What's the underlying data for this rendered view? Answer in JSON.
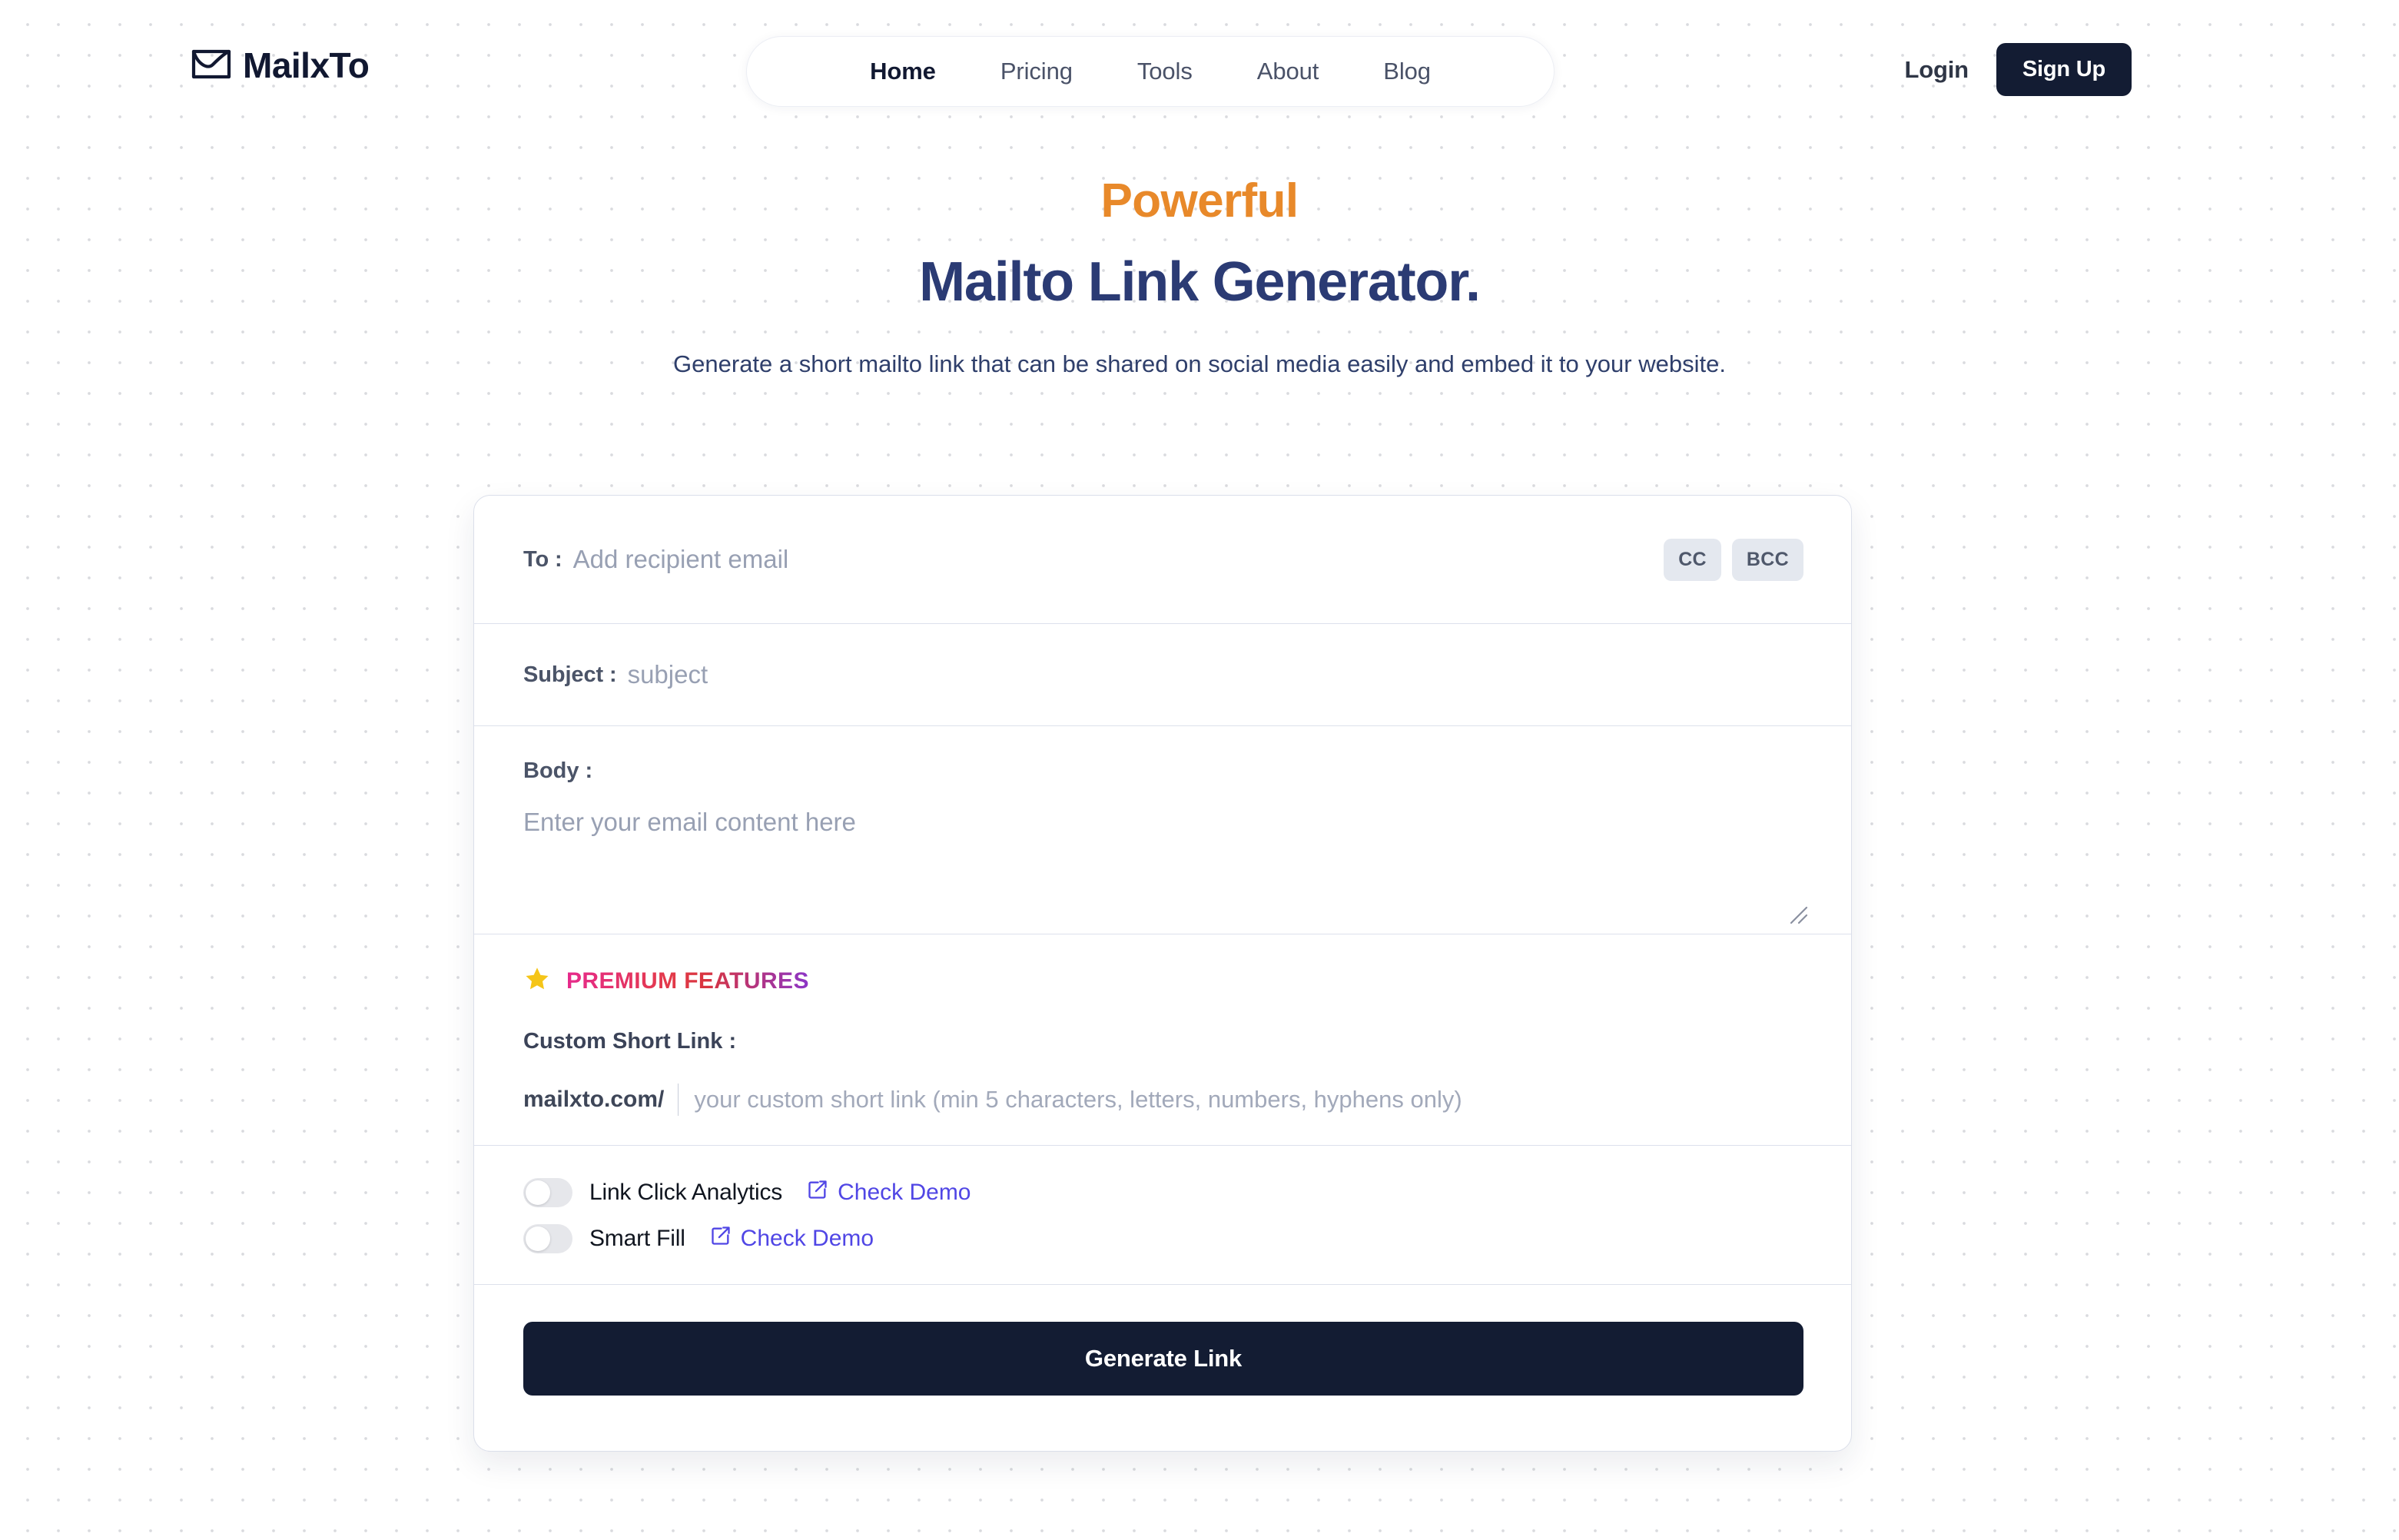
{
  "brand": {
    "name": "MailxTo",
    "logo_icon": "envelope-check-icon"
  },
  "nav": {
    "items": [
      {
        "label": "Home",
        "active": true
      },
      {
        "label": "Pricing",
        "active": false
      },
      {
        "label": "Tools",
        "active": false
      },
      {
        "label": "About",
        "active": false
      },
      {
        "label": "Blog",
        "active": false
      }
    ]
  },
  "auth": {
    "login_label": "Login",
    "signup_label": "Sign Up"
  },
  "hero": {
    "eyebrow": "Powerful",
    "title": "Mailto Link Generator.",
    "subtitle": "Generate a short mailto link that can be shared on social media easily and embed it to your website."
  },
  "form": {
    "to": {
      "label": "To :",
      "value": "",
      "placeholder": "Add recipient email"
    },
    "cc_label": "CC",
    "bcc_label": "BCC",
    "subject": {
      "label": "Subject :",
      "value": "",
      "placeholder": "subject"
    },
    "body": {
      "label": "Body :",
      "value": "",
      "placeholder": "Enter your email content here"
    },
    "premium": {
      "star_icon": "star-icon",
      "title": "PREMIUM FEATURES",
      "custom_link_label": "Custom Short Link :",
      "domain_prefix": "mailxto.com/",
      "short_link_value": "",
      "short_link_placeholder": "your custom short link (min 5 characters, letters, numbers, hyphens only)"
    },
    "toggles": [
      {
        "label": "Link Click Analytics",
        "enabled": false,
        "demo_label": "Check Demo",
        "demo_icon": "external-link-icon"
      },
      {
        "label": "Smart Fill",
        "enabled": false,
        "demo_label": "Check Demo",
        "demo_icon": "external-link-icon"
      }
    ],
    "submit_label": "Generate Link"
  },
  "colors": {
    "accent_orange": "#e8892a",
    "title_navy": "#2b3b74",
    "dark": "#131c33",
    "link_indigo": "#5046e5",
    "premium_gradient_start": "#e62a8c",
    "premium_gradient_mid": "#e33a4a",
    "premium_gradient_end": "#8b35c8",
    "star_gold": "#f5c518"
  }
}
